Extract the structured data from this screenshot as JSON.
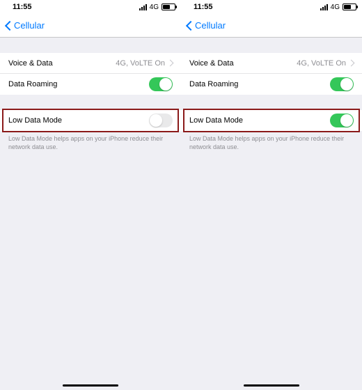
{
  "screens": [
    {
      "status": {
        "time": "11:55",
        "network": "4G"
      },
      "nav": {
        "back": "Cellular"
      },
      "rows": {
        "voiceData": {
          "label": "Voice & Data",
          "value": "4G, VoLTE On"
        },
        "roaming": {
          "label": "Data Roaming"
        },
        "lowData": {
          "label": "Low Data Mode",
          "on": false
        }
      },
      "footer": "Low Data Mode helps apps on your iPhone reduce their network data use."
    },
    {
      "status": {
        "time": "11:55",
        "network": "4G"
      },
      "nav": {
        "back": "Cellular"
      },
      "rows": {
        "voiceData": {
          "label": "Voice & Data",
          "value": "4G, VoLTE On"
        },
        "roaming": {
          "label": "Data Roaming"
        },
        "lowData": {
          "label": "Low Data Mode",
          "on": true
        }
      },
      "footer": "Low Data Mode helps apps on your iPhone reduce their network data use."
    }
  ]
}
